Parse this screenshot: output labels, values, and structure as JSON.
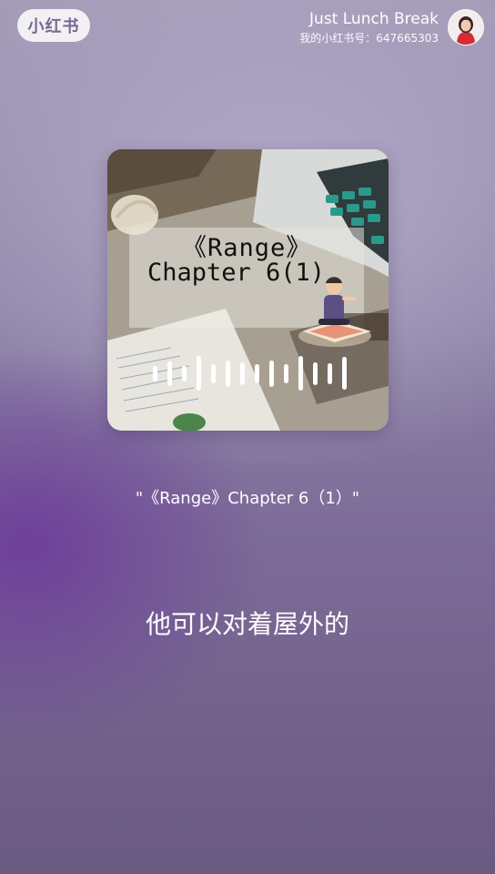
{
  "header": {
    "logo_text": "小红书",
    "user_name": "Just Lunch Break",
    "user_id_line": "我的小红书号：647665303"
  },
  "cover": {
    "title_line1": "《Range》",
    "title_line2": "Chapter 6(1)",
    "waveform_levels": [
      0.45,
      0.7,
      0.45,
      1.0,
      0.55,
      0.75,
      0.65,
      0.55,
      0.75,
      0.55,
      1.0,
      0.65,
      0.6,
      0.95
    ]
  },
  "track_title": "\"《Range》Chapter 6（1）\"",
  "lyric_line": "他可以对着屋外的"
}
